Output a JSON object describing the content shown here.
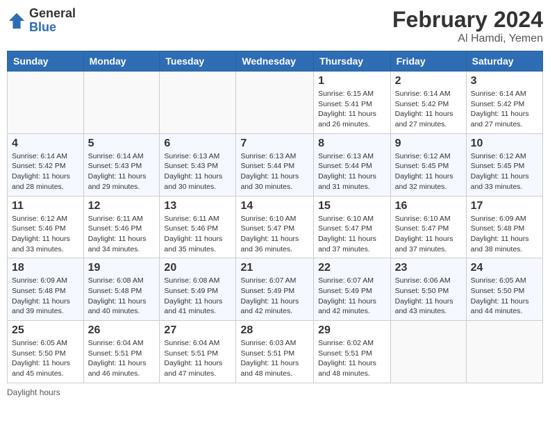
{
  "logo": {
    "general": "General",
    "blue": "Blue"
  },
  "header": {
    "title": "February 2024",
    "subtitle": "Al Hamdi, Yemen"
  },
  "weekdays": [
    "Sunday",
    "Monday",
    "Tuesday",
    "Wednesday",
    "Thursday",
    "Friday",
    "Saturday"
  ],
  "weeks": [
    [
      {
        "day": "",
        "info": ""
      },
      {
        "day": "",
        "info": ""
      },
      {
        "day": "",
        "info": ""
      },
      {
        "day": "",
        "info": ""
      },
      {
        "day": "1",
        "info": "Sunrise: 6:15 AM\nSunset: 5:41 PM\nDaylight: 11 hours and 26 minutes."
      },
      {
        "day": "2",
        "info": "Sunrise: 6:14 AM\nSunset: 5:42 PM\nDaylight: 11 hours and 27 minutes."
      },
      {
        "day": "3",
        "info": "Sunrise: 6:14 AM\nSunset: 5:42 PM\nDaylight: 11 hours and 27 minutes."
      }
    ],
    [
      {
        "day": "4",
        "info": "Sunrise: 6:14 AM\nSunset: 5:42 PM\nDaylight: 11 hours and 28 minutes."
      },
      {
        "day": "5",
        "info": "Sunrise: 6:14 AM\nSunset: 5:43 PM\nDaylight: 11 hours and 29 minutes."
      },
      {
        "day": "6",
        "info": "Sunrise: 6:13 AM\nSunset: 5:43 PM\nDaylight: 11 hours and 30 minutes."
      },
      {
        "day": "7",
        "info": "Sunrise: 6:13 AM\nSunset: 5:44 PM\nDaylight: 11 hours and 30 minutes."
      },
      {
        "day": "8",
        "info": "Sunrise: 6:13 AM\nSunset: 5:44 PM\nDaylight: 11 hours and 31 minutes."
      },
      {
        "day": "9",
        "info": "Sunrise: 6:12 AM\nSunset: 5:45 PM\nDaylight: 11 hours and 32 minutes."
      },
      {
        "day": "10",
        "info": "Sunrise: 6:12 AM\nSunset: 5:45 PM\nDaylight: 11 hours and 33 minutes."
      }
    ],
    [
      {
        "day": "11",
        "info": "Sunrise: 6:12 AM\nSunset: 5:46 PM\nDaylight: 11 hours and 33 minutes."
      },
      {
        "day": "12",
        "info": "Sunrise: 6:11 AM\nSunset: 5:46 PM\nDaylight: 11 hours and 34 minutes."
      },
      {
        "day": "13",
        "info": "Sunrise: 6:11 AM\nSunset: 5:46 PM\nDaylight: 11 hours and 35 minutes."
      },
      {
        "day": "14",
        "info": "Sunrise: 6:10 AM\nSunset: 5:47 PM\nDaylight: 11 hours and 36 minutes."
      },
      {
        "day": "15",
        "info": "Sunrise: 6:10 AM\nSunset: 5:47 PM\nDaylight: 11 hours and 37 minutes."
      },
      {
        "day": "16",
        "info": "Sunrise: 6:10 AM\nSunset: 5:47 PM\nDaylight: 11 hours and 37 minutes."
      },
      {
        "day": "17",
        "info": "Sunrise: 6:09 AM\nSunset: 5:48 PM\nDaylight: 11 hours and 38 minutes."
      }
    ],
    [
      {
        "day": "18",
        "info": "Sunrise: 6:09 AM\nSunset: 5:48 PM\nDaylight: 11 hours and 39 minutes."
      },
      {
        "day": "19",
        "info": "Sunrise: 6:08 AM\nSunset: 5:48 PM\nDaylight: 11 hours and 40 minutes."
      },
      {
        "day": "20",
        "info": "Sunrise: 6:08 AM\nSunset: 5:49 PM\nDaylight: 11 hours and 41 minutes."
      },
      {
        "day": "21",
        "info": "Sunrise: 6:07 AM\nSunset: 5:49 PM\nDaylight: 11 hours and 42 minutes."
      },
      {
        "day": "22",
        "info": "Sunrise: 6:07 AM\nSunset: 5:49 PM\nDaylight: 11 hours and 42 minutes."
      },
      {
        "day": "23",
        "info": "Sunrise: 6:06 AM\nSunset: 5:50 PM\nDaylight: 11 hours and 43 minutes."
      },
      {
        "day": "24",
        "info": "Sunrise: 6:05 AM\nSunset: 5:50 PM\nDaylight: 11 hours and 44 minutes."
      }
    ],
    [
      {
        "day": "25",
        "info": "Sunrise: 6:05 AM\nSunset: 5:50 PM\nDaylight: 11 hours and 45 minutes."
      },
      {
        "day": "26",
        "info": "Sunrise: 6:04 AM\nSunset: 5:51 PM\nDaylight: 11 hours and 46 minutes."
      },
      {
        "day": "27",
        "info": "Sunrise: 6:04 AM\nSunset: 5:51 PM\nDaylight: 11 hours and 47 minutes."
      },
      {
        "day": "28",
        "info": "Sunrise: 6:03 AM\nSunset: 5:51 PM\nDaylight: 11 hours and 48 minutes."
      },
      {
        "day": "29",
        "info": "Sunrise: 6:02 AM\nSunset: 5:51 PM\nDaylight: 11 hours and 48 minutes."
      },
      {
        "day": "",
        "info": ""
      },
      {
        "day": "",
        "info": ""
      }
    ]
  ],
  "footer": {
    "note": "Daylight hours"
  }
}
